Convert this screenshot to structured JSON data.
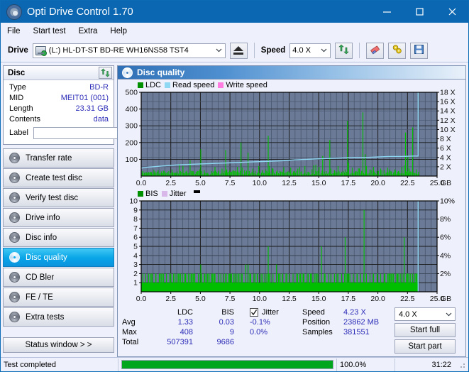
{
  "window": {
    "title": "Opti Drive Control 1.70",
    "icon": "disc-icon",
    "minimize": "minimize-icon",
    "maximize": "maximize-icon",
    "close": "close-icon"
  },
  "menu": {
    "items": [
      "File",
      "Start test",
      "Extra",
      "Help"
    ]
  },
  "toolbar": {
    "drive_label": "Drive",
    "drive_value": "(L:)  HL-DT-ST BD-RE  WH16NS58 TST4",
    "eject_label": "eject-button",
    "speed_label": "Speed",
    "speed_value": "4.0 X",
    "refresh_label": "refresh-button",
    "erase_label": "erase-button",
    "tools_label": "tools-button",
    "save_label": "save-button"
  },
  "disc_panel": {
    "title": "Disc",
    "refresh": "refresh-button",
    "rows": [
      {
        "key": "Type",
        "value": "BD-R"
      },
      {
        "key": "MID",
        "value": "MEIT01 (001)"
      },
      {
        "key": "Length",
        "value": "23.31 GB"
      },
      {
        "key": "Contents",
        "value": "data"
      }
    ],
    "label_key": "Label",
    "label_value": ""
  },
  "nav": {
    "items": [
      {
        "label": "Transfer rate",
        "active": false
      },
      {
        "label": "Create test disc",
        "active": false
      },
      {
        "label": "Verify test disc",
        "active": false
      },
      {
        "label": "Drive info",
        "active": false
      },
      {
        "label": "Disc info",
        "active": false
      },
      {
        "label": "Disc quality",
        "active": true
      },
      {
        "label": "CD Bler",
        "active": false
      },
      {
        "label": "FE / TE",
        "active": false
      },
      {
        "label": "Extra tests",
        "active": false
      }
    ],
    "status_window": "Status window > >"
  },
  "content": {
    "title": "Disc quality"
  },
  "stats": {
    "col_headers": [
      "",
      "LDC",
      "BIS"
    ],
    "rows": [
      {
        "label": "Avg",
        "ldc": "1.33",
        "bis": "0.03"
      },
      {
        "label": "Max",
        "ldc": "408",
        "bis": "9"
      },
      {
        "label": "Total",
        "ldc": "507391",
        "bis": "9686"
      }
    ],
    "jitter_label": "Jitter",
    "jitter_checked": true,
    "jitter_values": [
      "-0.1%",
      "0.0%"
    ],
    "speed_label": "Speed",
    "speed_value": "4.23 X",
    "position_label": "Position",
    "position_value": "23862 MB",
    "samples_label": "Samples",
    "samples_value": "381551",
    "speed_select": "4.0 X",
    "start_full": "Start full",
    "start_part": "Start part"
  },
  "statusbar": {
    "text": "Test completed",
    "percent": "100.0%",
    "progress": 100,
    "elapsed": "31:22"
  },
  "colors": {
    "accent": "#0b67b2",
    "ldc_green": "#00bf00",
    "read_speed": "#8fd8f4",
    "write_speed": "#ff7de0",
    "jitter": "#d8b8e8",
    "plot_bg": "#6b7a96",
    "progress_green": "#00a61e",
    "value_blue": "#2d2db8"
  },
  "chart_data": [
    {
      "type": "line",
      "name": "ldc-chart",
      "title": "",
      "xlabel": "GB",
      "ylabel": "",
      "x": [
        0,
        25
      ],
      "xlim": [
        0,
        25
      ],
      "xticks": [
        0.0,
        2.5,
        5.0,
        7.5,
        10.0,
        12.5,
        15.0,
        17.5,
        20.0,
        22.5,
        25.0
      ],
      "xticklabels": [
        "0.0",
        "2.5",
        "5.0",
        "7.5",
        "10.0",
        "12.5",
        "15.0",
        "17.5",
        "20.0",
        "22.5",
        "25.0"
      ],
      "ylim": [
        0,
        500
      ],
      "yticks": [
        100,
        200,
        300,
        400,
        500
      ],
      "yticklabels": [
        "100",
        "200",
        "300",
        "400",
        "500"
      ],
      "y2lim": [
        0,
        18
      ],
      "y2ticks": [
        2,
        4,
        6,
        8,
        10,
        12,
        14,
        16,
        18
      ],
      "y2ticklabels": [
        "2 X",
        "4 X",
        "6 X",
        "8 X",
        "10 X",
        "12 X",
        "14 X",
        "16 X",
        "18 X"
      ],
      "legend": [
        {
          "label": "LDC",
          "color": "#00bf00"
        },
        {
          "label": "Read speed",
          "color": "#8fd8f4"
        },
        {
          "label": "Write speed",
          "color": "#ff7de0"
        }
      ],
      "legend_position": "top-left",
      "grid": true,
      "series": [
        {
          "name": "LDC",
          "color": "#00bf00",
          "type": "bar",
          "x": [
            0.1,
            0.3,
            0.5,
            0.8,
            1.1,
            1.4,
            1.7,
            2.0,
            2.3,
            2.6,
            2.9,
            3.2,
            3.5,
            3.8,
            4.1,
            4.3,
            4.6,
            4.9,
            5.0,
            5.3,
            5.6,
            5.9,
            6.2,
            6.5,
            6.8,
            7.1,
            7.2,
            7.5,
            7.8,
            8.1,
            8.4,
            8.7,
            9.0,
            9.1,
            9.4,
            9.6,
            9.9,
            10.2,
            10.5,
            10.7,
            10.8,
            11.1,
            11.4,
            11.7,
            12.0,
            12.3,
            12.6,
            12.9,
            13.2,
            13.5,
            13.8,
            14.1,
            14.4,
            14.7,
            15.0,
            15.3,
            15.6,
            15.9,
            16.0,
            16.3,
            16.6,
            16.9,
            17.2,
            17.4,
            17.5,
            17.8,
            18.1,
            18.4,
            18.7,
            18.9,
            19.0,
            19.3,
            19.6,
            19.9,
            20.2,
            20.5,
            20.8,
            21.1,
            21.4,
            21.7,
            22.0,
            22.3,
            22.5,
            22.6,
            22.9,
            23.2,
            23.4
          ],
          "values": [
            30,
            22,
            18,
            25,
            20,
            35,
            18,
            22,
            30,
            25,
            20,
            28,
            60,
            22,
            95,
            30,
            25,
            40,
            160,
            35,
            20,
            30,
            55,
            25,
            45,
            155,
            40,
            25,
            30,
            55,
            200,
            35,
            140,
            30,
            45,
            25,
            60,
            35,
            40,
            240,
            60,
            45,
            25,
            30,
            40,
            25,
            50,
            30,
            45,
            28,
            60,
            25,
            40,
            30,
            55,
            120,
            30,
            215,
            45,
            35,
            60,
            25,
            40,
            330,
            80,
            50,
            30,
            45,
            380,
            130,
            60,
            40,
            55,
            30,
            45,
            35,
            50,
            28,
            40,
            30,
            55,
            260,
            120,
            45,
            290,
            40,
            25
          ]
        },
        {
          "name": "Read speed",
          "color": "#8fd8f4",
          "type": "line",
          "axis": "right",
          "x": [
            0.0,
            0.5,
            1.0,
            1.5,
            2.0,
            3.0,
            4.0,
            5.0,
            6.0,
            7.0,
            8.0,
            9.0,
            10.0,
            11.0,
            12.0,
            13.0,
            14.0,
            15.0,
            16.0,
            17.0,
            18.0,
            19.0,
            20.0,
            21.0,
            22.0,
            23.0,
            23.4,
            23.4
          ],
          "values": [
            1.7,
            1.9,
            2.0,
            2.1,
            2.2,
            2.4,
            2.5,
            2.6,
            2.7,
            2.8,
            2.9,
            3.0,
            3.1,
            3.2,
            3.3,
            3.5,
            3.6,
            3.7,
            3.8,
            3.9,
            4.0,
            4.0,
            4.1,
            4.2,
            4.2,
            4.3,
            4.3,
            18.0
          ]
        }
      ]
    },
    {
      "type": "line",
      "name": "bis-chart",
      "title": "",
      "xlabel": "GB",
      "ylabel": "",
      "xlim": [
        0,
        25
      ],
      "xticks": [
        0.0,
        2.5,
        5.0,
        7.5,
        10.0,
        12.5,
        15.0,
        17.5,
        20.0,
        22.5,
        25.0
      ],
      "xticklabels": [
        "0.0",
        "2.5",
        "5.0",
        "7.5",
        "10.0",
        "12.5",
        "15.0",
        "17.5",
        "20.0",
        "22.5",
        "25.0"
      ],
      "ylim": [
        0,
        10
      ],
      "yticks": [
        1,
        2,
        3,
        4,
        5,
        6,
        7,
        8,
        9,
        10
      ],
      "yticklabels": [
        "1",
        "2",
        "3",
        "4",
        "5",
        "6",
        "7",
        "8",
        "9",
        "10"
      ],
      "y2lim": [
        0,
        10
      ],
      "y2ticks": [
        2,
        4,
        6,
        8,
        10
      ],
      "y2ticklabels": [
        "2%",
        "4%",
        "6%",
        "8%",
        "10%"
      ],
      "legend": [
        {
          "label": "BIS",
          "color": "#00bf00"
        },
        {
          "label": "Jitter",
          "color": "#d8b8e8"
        }
      ],
      "legend_position": "top-left",
      "grid": true,
      "series": [
        {
          "name": "BIS",
          "color": "#00bf00",
          "type": "bar",
          "x": [
            0.1,
            0.35,
            0.6,
            0.9,
            1.2,
            1.5,
            1.8,
            2.1,
            2.4,
            2.7,
            3.0,
            3.2,
            3.45,
            3.7,
            3.95,
            4.2,
            4.5,
            4.8,
            5.0,
            5.3,
            5.6,
            5.9,
            6.2,
            6.5,
            6.7,
            6.9,
            7.1,
            7.35,
            7.6,
            7.9,
            8.2,
            8.5,
            8.8,
            9.0,
            9.2,
            9.5,
            9.8,
            10.1,
            10.4,
            10.7,
            10.85,
            11.1,
            11.4,
            11.7,
            11.9,
            12.2,
            12.5,
            12.8,
            13.1,
            13.4,
            13.7,
            14.0,
            14.3,
            14.6,
            14.9,
            15.2,
            15.5,
            15.8,
            16.0,
            16.3,
            16.6,
            16.9,
            17.2,
            17.35,
            17.6,
            17.9,
            18.2,
            18.5,
            18.8,
            19.0,
            19.3,
            19.6,
            19.9,
            20.2,
            20.5,
            20.8,
            21.0,
            21.3,
            21.6,
            21.9,
            22.2,
            22.5,
            22.6,
            22.9,
            23.2,
            23.35
          ],
          "values": [
            2,
            2,
            2,
            2,
            2,
            2,
            2,
            2,
            2,
            2,
            2,
            2,
            2,
            2,
            2,
            2,
            2,
            2,
            3,
            2,
            2,
            2,
            2,
            2,
            2,
            2,
            2,
            2,
            2,
            2,
            2,
            2,
            3,
            3,
            2,
            2,
            2,
            2,
            2,
            5,
            2,
            2,
            3,
            2,
            2,
            2,
            2,
            2,
            2,
            2,
            2,
            2,
            2,
            2,
            2,
            5,
            2,
            2,
            2,
            2,
            2,
            2,
            6,
            2,
            2,
            2,
            2,
            2,
            9,
            2,
            2,
            2,
            2,
            2,
            2,
            2,
            2,
            2,
            2,
            2,
            6,
            2,
            2,
            2,
            2,
            2
          ]
        },
        {
          "name": "Jitter",
          "color": "#d8b8e8",
          "type": "line",
          "x": [],
          "values": []
        }
      ]
    }
  ]
}
